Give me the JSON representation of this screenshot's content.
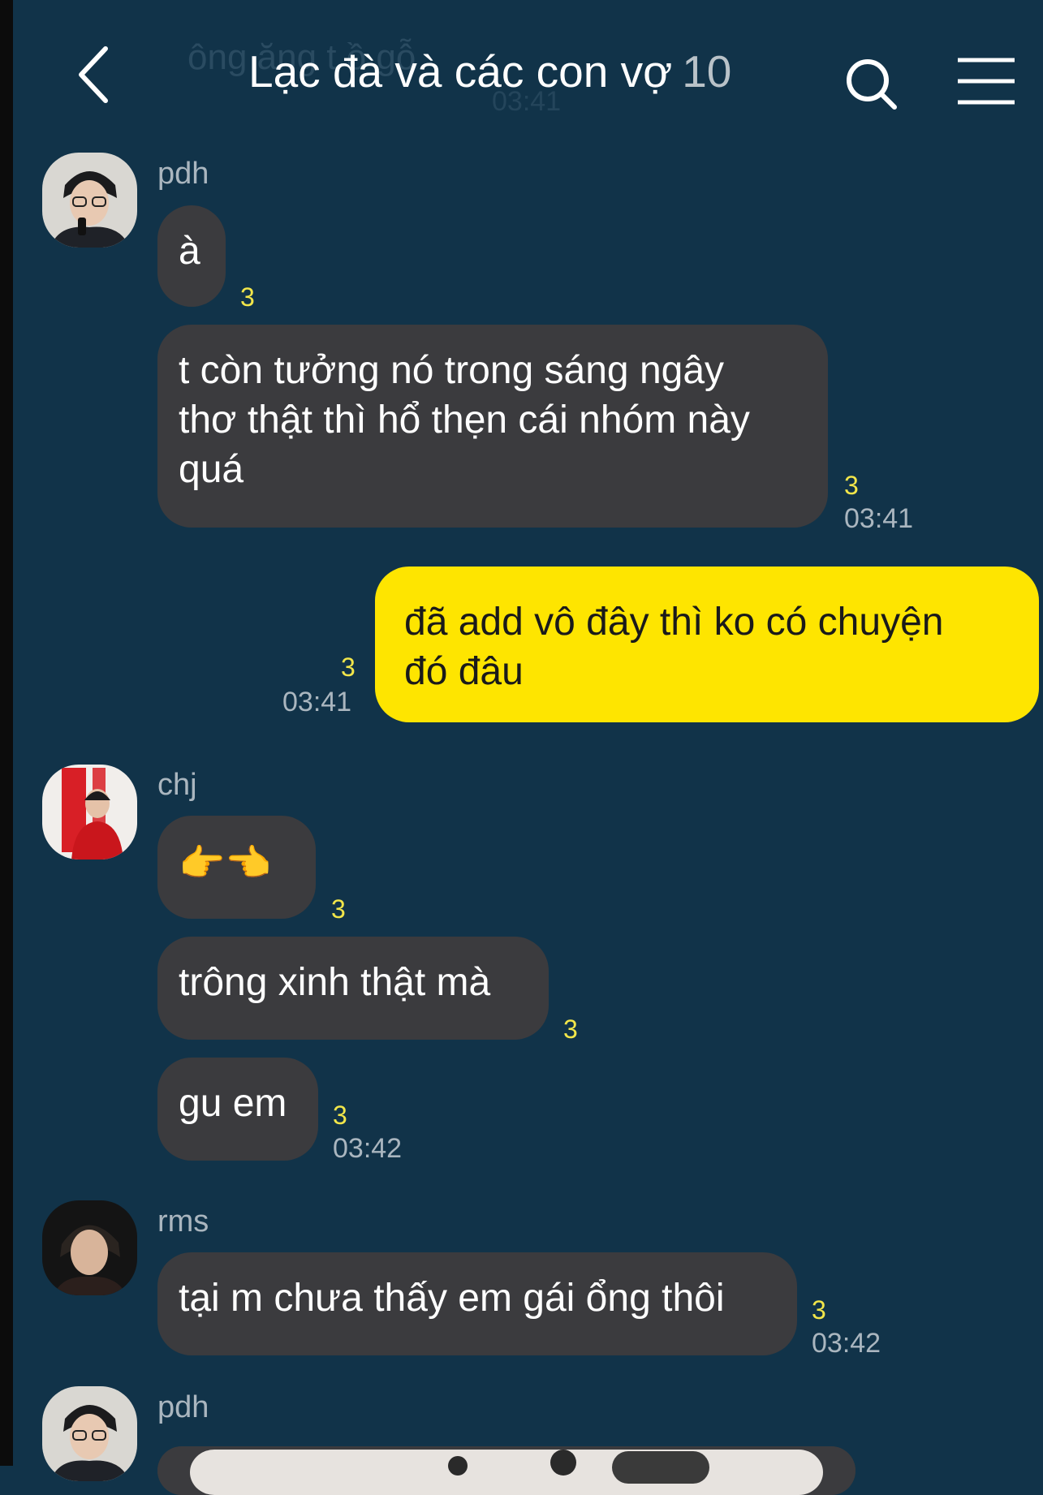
{
  "header": {
    "title": "Lạc đà và các con vợ",
    "member_count": "10",
    "ghost_text": "ông ăng t ồ gỗ",
    "ghost_time": "03:41"
  },
  "messages": [
    {
      "sender": "pdh",
      "text": "à",
      "unread": "3"
    },
    {
      "text": "t còn tưởng nó trong sáng ngây\nthơ thật thì hổ thẹn cái nhóm này\nquá",
      "unread": "3",
      "time": "03:41"
    },
    {
      "text": "đã add vô đây thì ko có chuyện\nđó đâu",
      "unread": "3",
      "time": "03:41"
    },
    {
      "sender": "chj",
      "text": "👉👈",
      "unread": "3"
    },
    {
      "text": "trông xinh thật mà",
      "unread": "3"
    },
    {
      "text": "gu em",
      "unread": "3",
      "time": "03:42"
    },
    {
      "sender": "rms",
      "text": "tại m chưa thấy em gái ổng thôi",
      "unread": "3",
      "time": "03:42"
    },
    {
      "sender": "pdh"
    }
  ],
  "colors": {
    "background": "#113349",
    "bubble_other": "#3b3b3e",
    "bubble_mine": "#fee500",
    "unread": "#f2e64a"
  }
}
